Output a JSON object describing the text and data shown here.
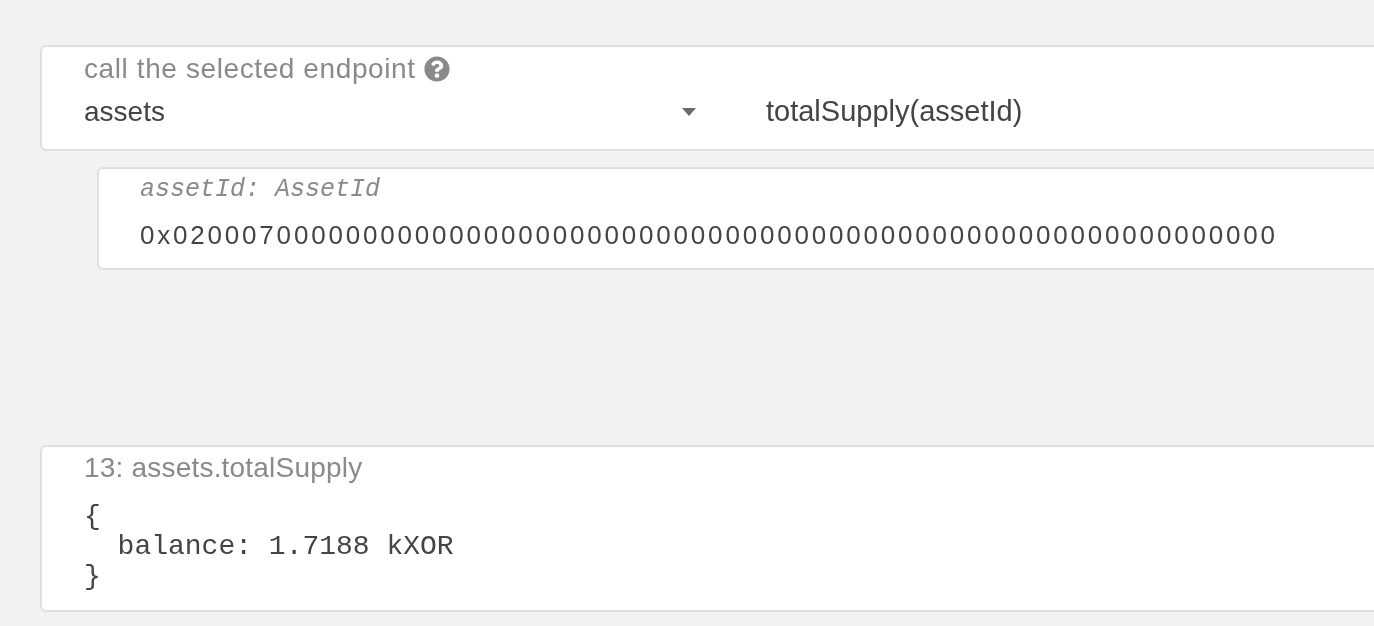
{
  "endpoint": {
    "label": "call the selected endpoint",
    "section": "assets",
    "method": "totalSupply(assetId)"
  },
  "params": [
    {
      "label": "assetId: AssetId",
      "value": "0x0200070000000000000000000000000000000000000000000000000000000000"
    }
  ],
  "results": [
    {
      "title": "13: assets.totalSupply",
      "output": "{\n  balance: 1.7188 kXOR\n}"
    }
  ]
}
